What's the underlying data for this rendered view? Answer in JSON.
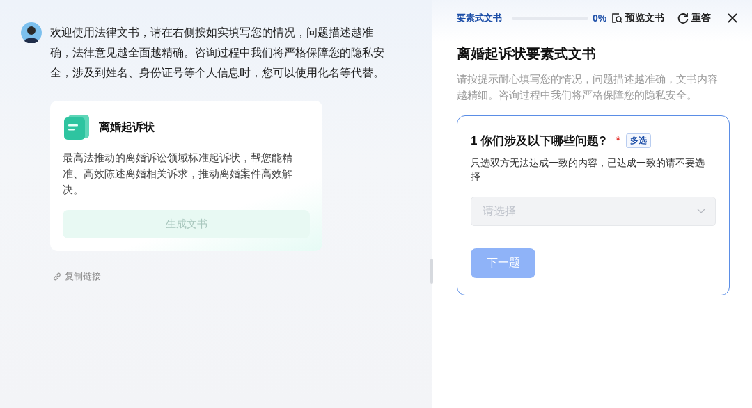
{
  "chat": {
    "message": "欢迎使用法律文书，请在右侧按如实填写您的情况，问题描述越准确，法律意见越全面越精确。咨询过程中我们将严格保障您的隐私安全，涉及到姓名、身份证号等个人信息时，您可以使用化名等代替。",
    "card": {
      "title": "离婚起诉状",
      "description": "最高法推动的离婚诉讼领域标准起诉状，帮您能精准、高效陈述离婚相关诉求，推动离婚案件高效解决。",
      "button": {
        "label": "生成文书",
        "disabled": true
      }
    },
    "copy_link": "复制链接"
  },
  "panel": {
    "header": {
      "label": "要素式文书",
      "progress": {
        "level": 0,
        "reading": "0%"
      },
      "preview": "预览文书",
      "reset": "重答"
    },
    "title": "离婚起诉状要素式文书",
    "description": "请按提示耐心填写您的情况，问题描述越准确，文书内容越精细。咨询过程中我们将严格保障您的隐私安全。",
    "question": {
      "number": "1",
      "text": "你们涉及以下哪些问题?",
      "required": true,
      "required_mark": "*",
      "tag": "多选",
      "hint": "只选双方无法达成一致的内容，已达成一致的请不要选择",
      "select": {
        "placeholder": "请选择"
      },
      "next": {
        "label": "下一题",
        "disabled": true
      }
    }
  }
}
